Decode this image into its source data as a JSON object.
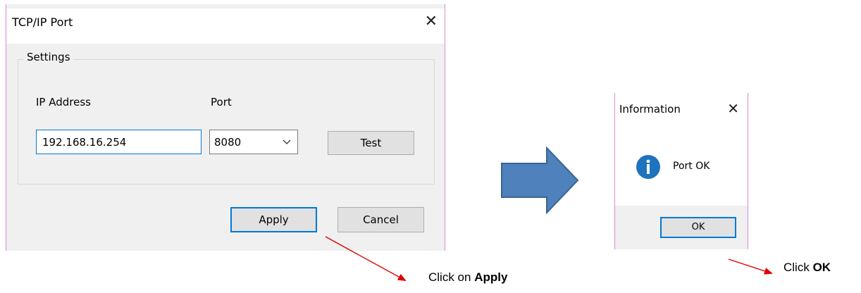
{
  "tcp_dialog": {
    "title": "TCP/IP Port",
    "close_glyph": "✕",
    "group_title": "Settings",
    "ip_label": "IP Address",
    "port_label": "Port",
    "ip_value": "192.168.16.254",
    "port_value": "8080",
    "test_label": "Test",
    "apply_label": "Apply",
    "cancel_label": "Cancel"
  },
  "info_dialog": {
    "title": "Information",
    "close_glyph": "✕",
    "message": "Port OK",
    "ok_label": "OK",
    "icon": "info-icon"
  },
  "captions": {
    "apply_prefix": "Click on ",
    "apply_bold": "Apply",
    "ok_prefix": "Click ",
    "ok_bold": "OK"
  },
  "colors": {
    "arrow_fill": "#4f81bd",
    "pointer_red": "#e00000",
    "focus_blue": "#0078d7",
    "info_icon": "#1e73be"
  }
}
